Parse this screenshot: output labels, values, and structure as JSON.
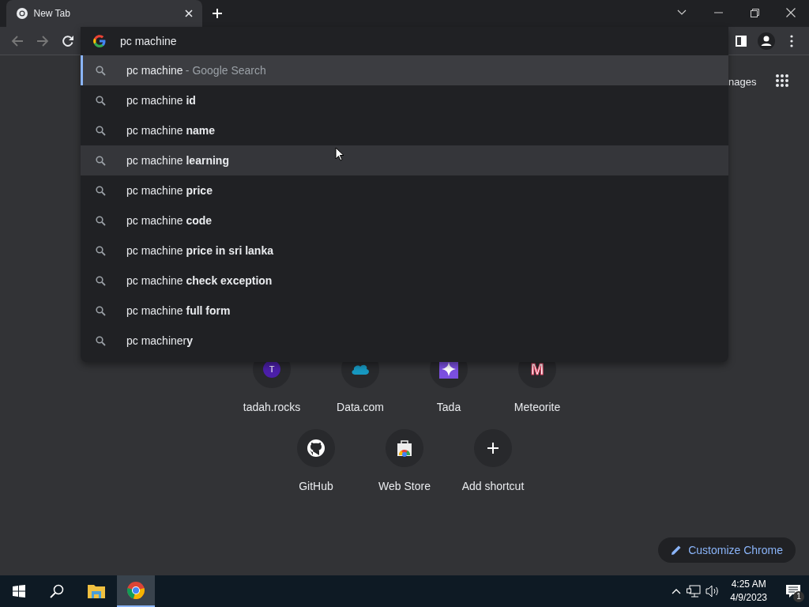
{
  "tab": {
    "title": "New Tab"
  },
  "omnibox": {
    "value": "pc machine"
  },
  "suggestions": [
    {
      "text": "pc machine",
      "description": "- Google Search",
      "selected": true,
      "hovered": false
    },
    {
      "text": "pc machine **id**",
      "selected": false,
      "hovered": false
    },
    {
      "text": "pc machine **name**",
      "selected": false,
      "hovered": false
    },
    {
      "text": "pc machine **learning**",
      "selected": false,
      "hovered": true
    },
    {
      "text": "pc machine **price**",
      "selected": false,
      "hovered": false
    },
    {
      "text": "pc machine **code**",
      "selected": false,
      "hovered": false
    },
    {
      "text": "pc machine **price in sri lanka**",
      "selected": false,
      "hovered": false
    },
    {
      "text": "pc machine **check exception**",
      "selected": false,
      "hovered": false
    },
    {
      "text": "pc machine **full form**",
      "selected": false,
      "hovered": false
    },
    {
      "text": "pc machiner**y**",
      "selected": false,
      "hovered": false
    }
  ],
  "header_link": "nages",
  "shortcut_rows": [
    [
      {
        "label": "tadah.rocks",
        "kind": "letter",
        "letter": "T"
      },
      {
        "label": "Data.com",
        "kind": "cloud"
      },
      {
        "label": "Tada",
        "kind": "sparkle"
      },
      {
        "label": "Meteorite",
        "kind": "tile",
        "letter": "M"
      }
    ],
    [
      {
        "label": "GitHub",
        "kind": "github"
      },
      {
        "label": "Web Store",
        "kind": "webstore"
      },
      {
        "label": "Add shortcut",
        "kind": "add"
      }
    ]
  ],
  "customize_button": "Customize Chrome",
  "taskbar": {
    "apps": [
      {
        "kind": "explorer",
        "active": false
      },
      {
        "kind": "chrome",
        "active": true
      }
    ],
    "time": "4:25 AM",
    "date": "4/9/2023",
    "notifications": "1"
  }
}
